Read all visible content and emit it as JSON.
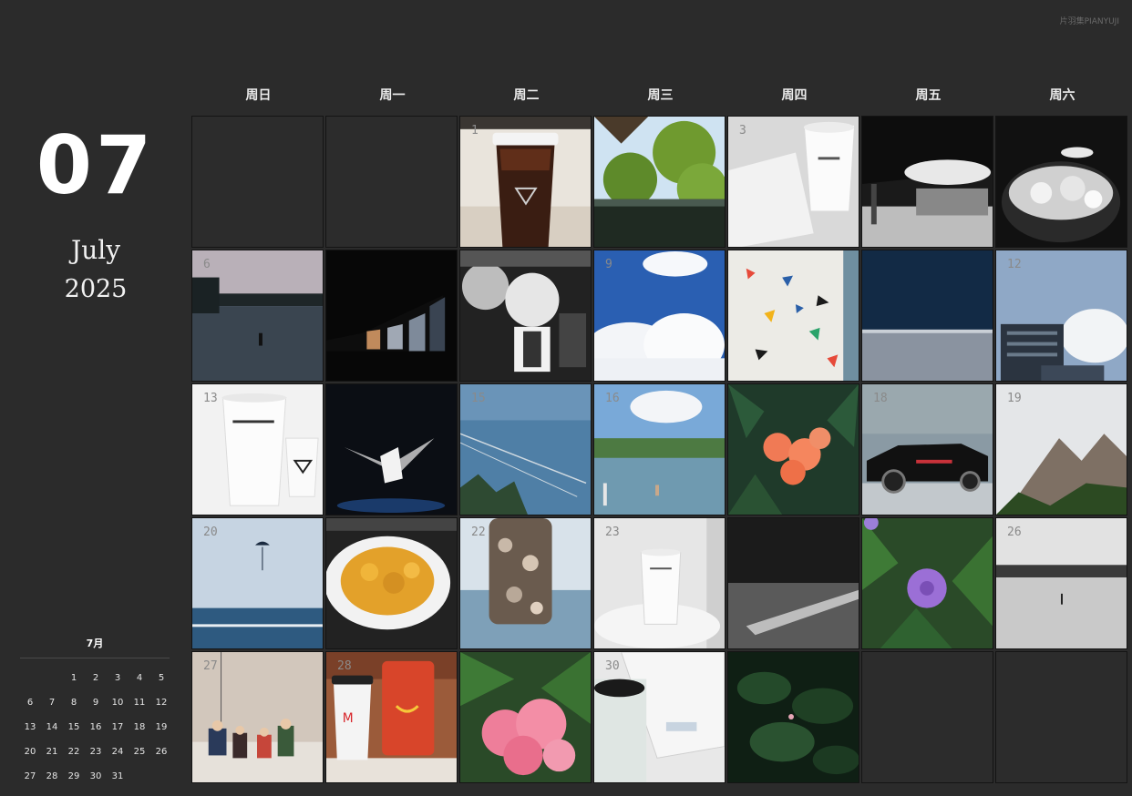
{
  "watermark": "片羽集PIANYUJI",
  "month_number": "07",
  "month_name": "July",
  "year": "2025",
  "weekdays": [
    "周日",
    "周一",
    "周二",
    "周三",
    "周四",
    "周五",
    "周六"
  ],
  "mini_calendar": {
    "title": "7月",
    "rows": [
      [
        "",
        "",
        "1",
        "2",
        "3",
        "4",
        "5"
      ],
      [
        "6",
        "7",
        "8",
        "9",
        "10",
        "11",
        "12"
      ],
      [
        "13",
        "14",
        "15",
        "16",
        "17",
        "18",
        "19"
      ],
      [
        "20",
        "21",
        "22",
        "23",
        "24",
        "25",
        "26"
      ],
      [
        "27",
        "28",
        "29",
        "30",
        "31",
        "",
        ""
      ]
    ]
  },
  "days": [
    {
      "day": "",
      "photo": "none"
    },
    {
      "day": "",
      "photo": "none"
    },
    {
      "day": "1",
      "photo": "iced-coffee-cup"
    },
    {
      "day": "",
      "photo": "pavilion-trees"
    },
    {
      "day": "3",
      "photo": "coffee-cup-notebook"
    },
    {
      "day": "",
      "photo": "building-overhang"
    },
    {
      "day": "",
      "photo": "glass-with-ice"
    },
    {
      "day": "6",
      "photo": "lake-sunset"
    },
    {
      "day": "",
      "photo": "dark-window-dusk"
    },
    {
      "day": "",
      "photo": "robot-figures"
    },
    {
      "day": "9",
      "photo": "blue-sky-clouds"
    },
    {
      "day": "",
      "photo": "terrazzo-pattern"
    },
    {
      "day": "",
      "photo": "tennis-court"
    },
    {
      "day": "12",
      "photo": "office-building-sky"
    },
    {
      "day": "13",
      "photo": "white-coffee-cups"
    },
    {
      "day": "",
      "photo": "night-sculpture"
    },
    {
      "day": "15",
      "photo": "fishing-lake"
    },
    {
      "day": "16",
      "photo": "lake-swimmers"
    },
    {
      "day": "",
      "photo": "orange-flowers"
    },
    {
      "day": "18",
      "photo": "black-car"
    },
    {
      "day": "19",
      "photo": "rocky-mountain"
    },
    {
      "day": "20",
      "photo": "sea-parasail"
    },
    {
      "day": "",
      "photo": "pasta-plate"
    },
    {
      "day": "22",
      "photo": "shell-jar"
    },
    {
      "day": "23",
      "photo": "coffee-cup-table"
    },
    {
      "day": "",
      "photo": "bw-pool"
    },
    {
      "day": "",
      "photo": "purple-flower"
    },
    {
      "day": "26",
      "photo": "misty-lake"
    },
    {
      "day": "27",
      "photo": "figurines"
    },
    {
      "day": "28",
      "photo": "mcdonalds-cup"
    },
    {
      "day": "",
      "photo": "pink-flowers"
    },
    {
      "day": "30",
      "photo": "mug-tray"
    },
    {
      "day": "",
      "photo": "lotus-leaves"
    },
    {
      "day": "",
      "photo": "none"
    },
    {
      "day": "",
      "photo": "none"
    }
  ]
}
